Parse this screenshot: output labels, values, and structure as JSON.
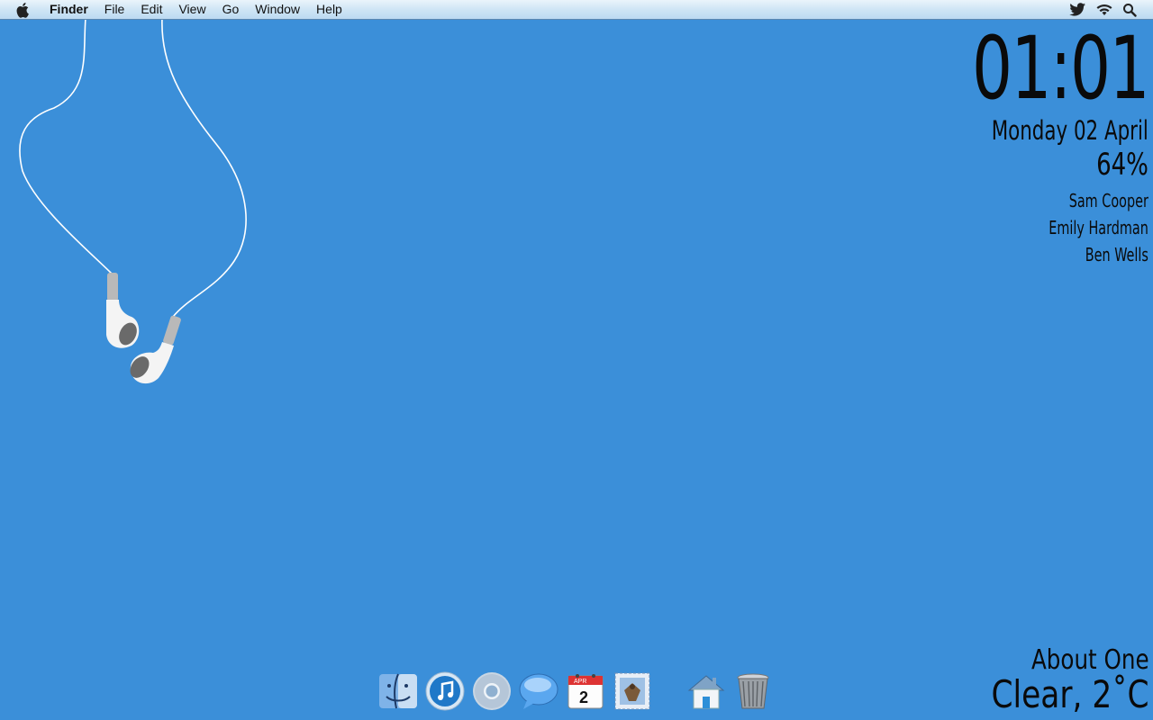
{
  "menubar": {
    "app_name": "Finder",
    "items": [
      "File",
      "Edit",
      "View",
      "Go",
      "Window",
      "Help"
    ],
    "status_icons": [
      "twitter-icon",
      "wifi-icon",
      "spotlight-search-icon"
    ]
  },
  "widgets": {
    "clock": "01:01",
    "date": "Monday 02 April",
    "battery": "64%",
    "contacts": [
      "Sam Cooper",
      "Emily Hardman",
      "Ben Wells"
    ]
  },
  "weather": {
    "time_text": "About One",
    "condition": "Clear, 2˚C"
  },
  "dock": {
    "apps": [
      "finder-icon",
      "itunes-icon",
      "chrome-icon",
      "ichat-icon",
      "ical-icon",
      "mail-icon",
      "home-folder-icon",
      "trash-icon"
    ],
    "ical_month": "APR",
    "ical_day": "2"
  },
  "colors": {
    "desktop": "#3b8fd9",
    "menubar": "#cfe5f5"
  }
}
